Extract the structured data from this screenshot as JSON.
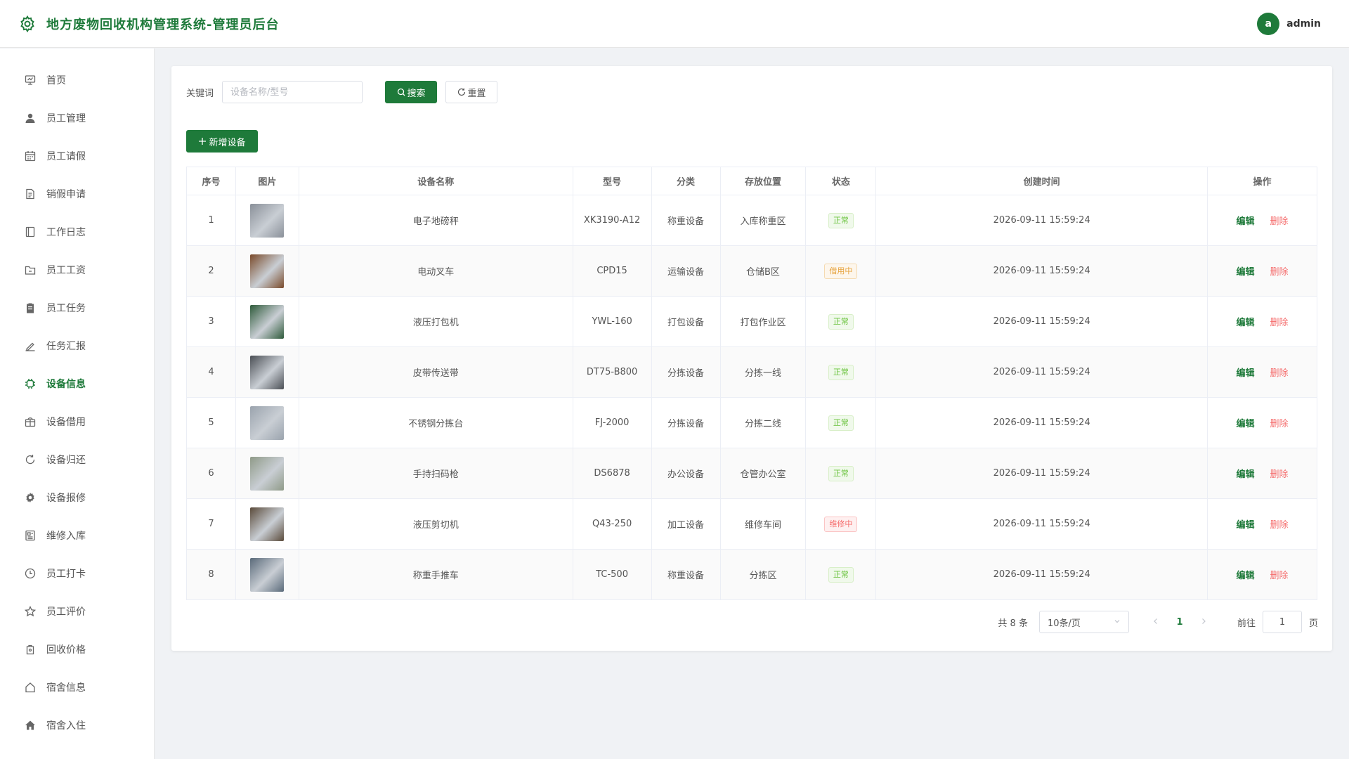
{
  "header": {
    "title": "地方废物回收机构管理系统-管理员后台",
    "logo_icon": "gear-icon",
    "avatar_letter": "a",
    "username": "admin",
    "brand_color": "#1e7a3a"
  },
  "sidebar": {
    "items": [
      {
        "label": "首页",
        "icon": "dashboard-icon"
      },
      {
        "label": "员工管理",
        "icon": "user-icon"
      },
      {
        "label": "员工请假",
        "icon": "calendar-icon"
      },
      {
        "label": "销假申请",
        "icon": "document-icon"
      },
      {
        "label": "工作日志",
        "icon": "notebook-icon"
      },
      {
        "label": "员工工资",
        "icon": "folder-icon"
      },
      {
        "label": "员工任务",
        "icon": "clipboard-icon"
      },
      {
        "label": "任务汇报",
        "icon": "edit-pen-icon"
      },
      {
        "label": "设备信息",
        "icon": "chip-icon",
        "active": true
      },
      {
        "label": "设备借用",
        "icon": "box-icon"
      },
      {
        "label": "设备归还",
        "icon": "refresh-icon"
      },
      {
        "label": "设备报修",
        "icon": "cog-icon"
      },
      {
        "label": "维修入库",
        "icon": "storage-icon"
      },
      {
        "label": "员工打卡",
        "icon": "clock-icon"
      },
      {
        "label": "员工评价",
        "icon": "star-icon"
      },
      {
        "label": "回收价格",
        "icon": "price-icon"
      },
      {
        "label": "宿舍信息",
        "icon": "house-outline-icon"
      },
      {
        "label": "宿舍入住",
        "icon": "house-filled-icon"
      }
    ]
  },
  "search": {
    "label": "关键词",
    "placeholder": "设备名称/型号",
    "search_label": "搜索",
    "reset_label": "重置"
  },
  "add_label": "新增设备",
  "table": {
    "columns": [
      "序号",
      "图片",
      "设备名称",
      "型号",
      "分类",
      "存放位置",
      "状态",
      "创建时间",
      "操作"
    ],
    "edit_label": "编辑",
    "delete_label": "删除",
    "rows": [
      {
        "no": "1",
        "name": "电子地磅秤",
        "model": "XK3190-A12",
        "category": "称重设备",
        "location": "入库称重区",
        "status": "正常",
        "status_type": "ok",
        "created": "2026-09-11 15:59:24",
        "thumb": "#8a9099"
      },
      {
        "no": "2",
        "name": "电动叉车",
        "model": "CPD15",
        "category": "运输设备",
        "location": "仓储B区",
        "status": "借用中",
        "status_type": "borrow",
        "created": "2026-09-11 15:59:24",
        "thumb": "#7a4a2a"
      },
      {
        "no": "3",
        "name": "液压打包机",
        "model": "YWL-160",
        "category": "打包设备",
        "location": "打包作业区",
        "status": "正常",
        "status_type": "ok",
        "created": "2026-09-11 15:59:24",
        "thumb": "#2e5a3a"
      },
      {
        "no": "4",
        "name": "皮带传送带",
        "model": "DT75-B800",
        "category": "分拣设备",
        "location": "分拣一线",
        "status": "正常",
        "status_type": "ok",
        "created": "2026-09-11 15:59:24",
        "thumb": "#4a4e54"
      },
      {
        "no": "5",
        "name": "不锈钢分拣台",
        "model": "FJ-2000",
        "category": "分拣设备",
        "location": "分拣二线",
        "status": "正常",
        "status_type": "ok",
        "created": "2026-09-11 15:59:24",
        "thumb": "#9aa3ad"
      },
      {
        "no": "6",
        "name": "手持扫码枪",
        "model": "DS6878",
        "category": "办公设备",
        "location": "仓管办公室",
        "status": "正常",
        "status_type": "ok",
        "created": "2026-09-11 15:59:24",
        "thumb": "#8f9a88"
      },
      {
        "no": "7",
        "name": "液压剪切机",
        "model": "Q43-250",
        "category": "加工设备",
        "location": "维修车间",
        "status": "维修中",
        "status_type": "repair",
        "created": "2026-09-11 15:59:24",
        "thumb": "#5a4a3a"
      },
      {
        "no": "8",
        "name": "称重手推车",
        "model": "TC-500",
        "category": "称重设备",
        "location": "分拣区",
        "status": "正常",
        "status_type": "ok",
        "created": "2026-09-11 15:59:24",
        "thumb": "#5a6a7a"
      }
    ]
  },
  "pager": {
    "total": "共 8 条",
    "page_size": "10条/页",
    "current": "1",
    "goto_label": "前往",
    "goto_value": "1",
    "page_suffix": "页"
  }
}
